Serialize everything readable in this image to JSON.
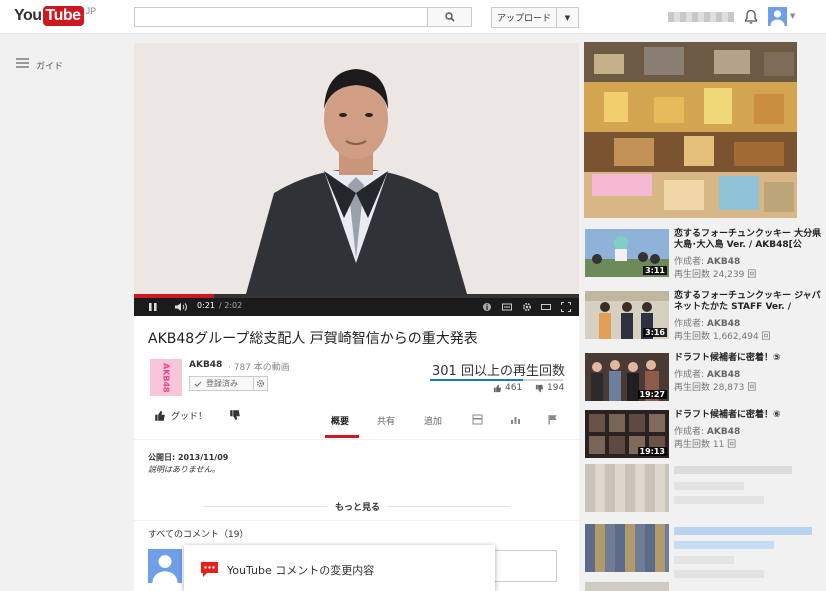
{
  "header": {
    "logo_you": "You",
    "logo_tube": "Tube",
    "logo_region": "JP",
    "search_placeholder": "",
    "upload_label": "アップロード"
  },
  "guide": {
    "label": "ガイド"
  },
  "player": {
    "time_current": "0:21",
    "time_total": "/ 2:02",
    "progress": 0.18
  },
  "video": {
    "title": "AKB48グループ総支配人 戸賀崎智信からの重大発表",
    "channel": "AKB48",
    "channel_video_count": "· 787 本の動画",
    "channel_logo": "AKB48",
    "subscribed_label": "登録済み",
    "views": "301 回以上の再生回数",
    "likes": "461",
    "dislikes": "194",
    "like_label": "グッド！",
    "tabs": [
      "概要",
      "共有",
      "追加"
    ],
    "published": "公開日: 2013/11/09",
    "no_description": "説明はありません。",
    "more_label": "もっと見る"
  },
  "comments": {
    "label": "すべてのコメント（19）",
    "popup_text": "YouTube コメントの変更内容"
  },
  "related": [
    {
      "title": "恋するフォーチュンクッキー 大分県 大島･大入島 Ver. / AKB48[公",
      "author_prefix": "作成者:",
      "author": "AKB48",
      "views": "再生回数 24,239 回",
      "duration": "3:11"
    },
    {
      "title": "恋するフォーチュンクッキー ジャパネットたかた STAFF Ver. /",
      "author_prefix": "作成者:",
      "author": "AKB48",
      "views": "再生回数 1,662,494 回",
      "duration": "3:16"
    },
    {
      "title": "ドラフト候補者に密着！⑤",
      "author_prefix": "作成者:",
      "author": "AKB48",
      "views": "再生回数 28,873 回",
      "duration": "19:27"
    },
    {
      "title": "ドラフト候補者に密着！⑥",
      "author_prefix": "作成者:",
      "author": "AKB48",
      "views": "再生回数 11 回",
      "duration": "19:13"
    }
  ],
  "colors": {
    "brand_red": "#cc181e",
    "link_blue": "#167ac6",
    "views_bar": "#167ac6"
  }
}
